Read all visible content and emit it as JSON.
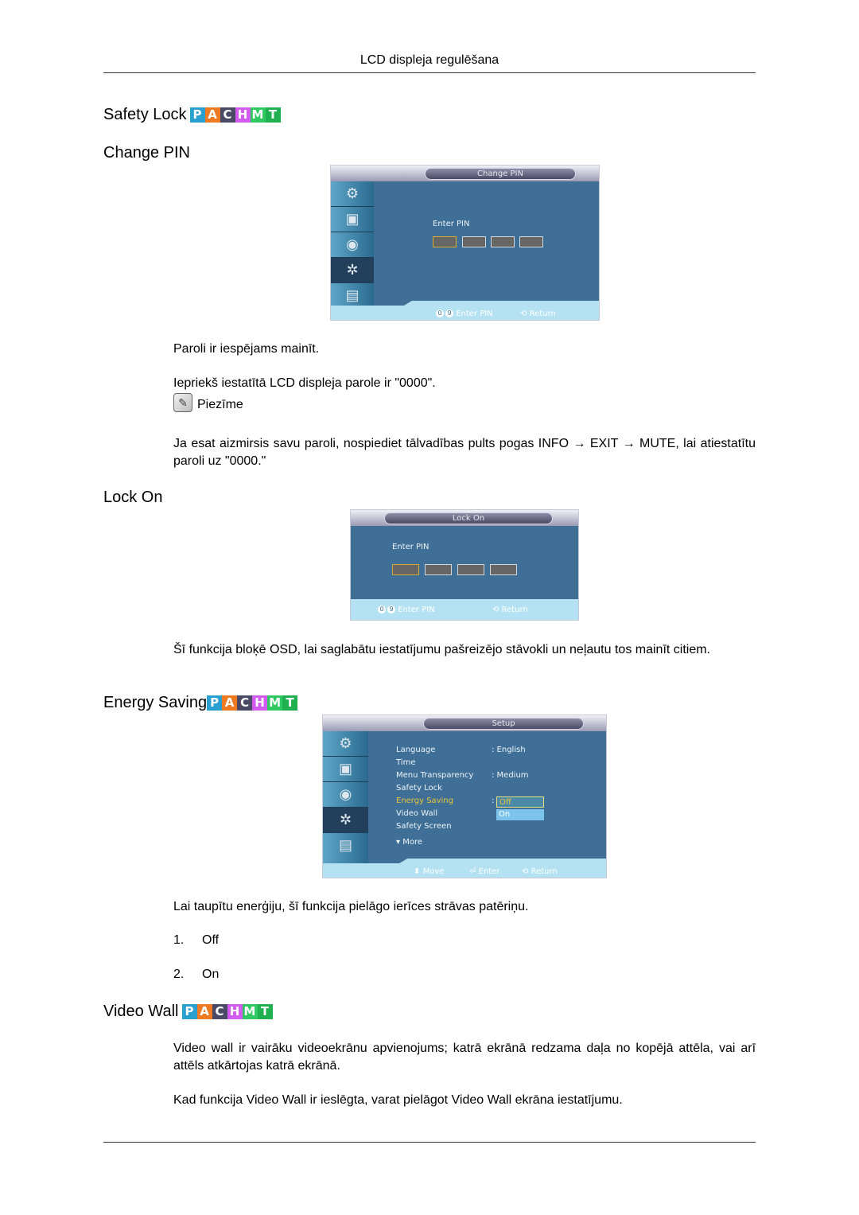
{
  "header": {
    "title": "LCD displeja regulēšana"
  },
  "badges": {
    "letters": [
      "P",
      "A",
      "C",
      "H",
      "M",
      "T"
    ],
    "colors": [
      "#2aa0d0",
      "#f07a22",
      "#4a4a66",
      "#d35cf0",
      "#30c860",
      "#20b050"
    ]
  },
  "sections": {
    "safety_lock": {
      "title": "Safety Lock"
    },
    "change_pin": {
      "title": "Change PIN",
      "osd": {
        "title": "Change PIN",
        "enter_pin_label": "Enter PIN",
        "hint_keys": [
          "0",
          "9"
        ],
        "hint_enter": "Enter PIN",
        "hint_return": "Return"
      },
      "para1": "Paroli ir iespējams mainīt.",
      "para2": "Iepriekš iestatītā LCD displeja parole ir \"0000\".",
      "note_label": "Piezīme",
      "note_text": "Ja esat aizmirsis savu paroli, nospiediet tālvadības pults pogas INFO → EXIT → MUTE, lai atiestatītu paroli uz \"0000.\""
    },
    "lock_on": {
      "title": "Lock On",
      "osd": {
        "title": "Lock On",
        "enter_pin_label": "Enter PIN",
        "hint_keys": [
          "0",
          "9"
        ],
        "hint_enter": "Enter PIN",
        "hint_return": "Return"
      },
      "para": "Šī funkcija bloķē OSD, lai saglabātu iestatījumu pašreizējo stāvokli un neļautu tos mainīt citiem."
    },
    "energy_saving": {
      "title": "Energy Saving",
      "osd": {
        "title": "Setup",
        "menu": [
          {
            "label": "Language",
            "value": ": English"
          },
          {
            "label": "Time",
            "value": ""
          },
          {
            "label": "Menu Transparency",
            "value": ": Medium"
          },
          {
            "label": "Safety Lock",
            "value": ""
          },
          {
            "label": "Energy Saving",
            "value": ":",
            "highlighted": true
          },
          {
            "label": "Video Wall",
            "value": ""
          },
          {
            "label": "Safety Screen",
            "value": ""
          }
        ],
        "more_label": "More",
        "dropdown_options": [
          "Off",
          "On"
        ],
        "dropdown_selected": "Off",
        "hint_move": "Move",
        "hint_enter": "Enter",
        "hint_return": "Return"
      },
      "para": "Lai taupītu enerģiju, šī funkcija pielāgo ierīces strāvas patēriņu.",
      "options": [
        {
          "num": "1.",
          "label": "Off"
        },
        {
          "num": "2.",
          "label": "On"
        }
      ]
    },
    "video_wall": {
      "title": "Video Wall",
      "para1_bold": "Video wall",
      "para1_rest": " ir vairāku videoekrānu apvienojums; katrā ekrānā redzama daļa no kopējā attēla, vai arī attēls atkārtojas katrā ekrānā.",
      "para2_a": "Kad funkcija ",
      "para2_b": "Video Wall",
      "para2_c": " ir ieslēgta, varat pielāgot ",
      "para2_d": "Video Wall",
      "para2_e": " ekrāna iestatījumu."
    }
  },
  "osd_sidebar_icons": [
    "input-icon",
    "picture-icon",
    "sound-icon",
    "setup-gear-icon",
    "multi-control-icon"
  ]
}
